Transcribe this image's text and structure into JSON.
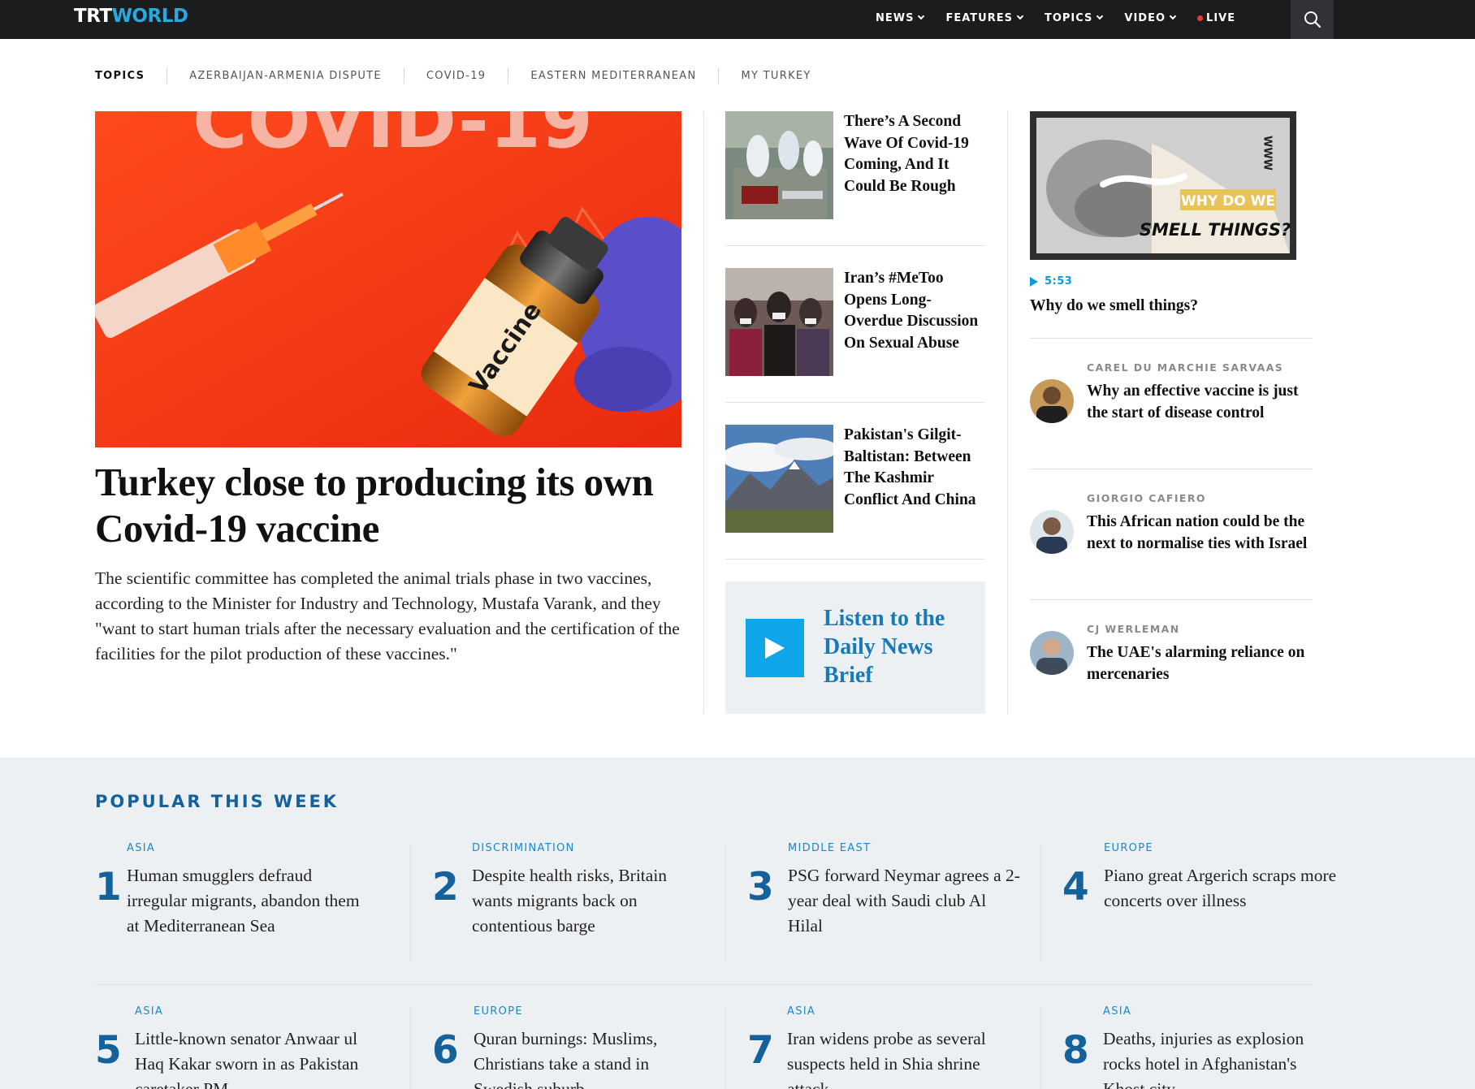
{
  "header": {
    "logo": {
      "part1": "TRT",
      "part2": "WORLD"
    },
    "nav": [
      {
        "label": "NEWS",
        "has_menu": true
      },
      {
        "label": "FEATURES",
        "has_menu": true
      },
      {
        "label": "TOPICS",
        "has_menu": true
      },
      {
        "label": "VIDEO",
        "has_menu": true
      },
      {
        "label": "LIVE",
        "has_menu": false
      }
    ],
    "search_icon": "search-icon"
  },
  "topics": {
    "label": "TOPICS",
    "items": [
      "AZERBAIJAN-ARMENIA DISPUTE",
      "COVID-19",
      "EASTERN MEDITERRANEAN",
      "MY TURKEY"
    ]
  },
  "lead": {
    "title": "Turkey close to producing its own Covid-19 vaccine",
    "summary": "The scientific committee has completed the animal trials phase in two vaccines, according to the Minister for Industry and Technology, Mustafa Varank, and they \"want to start human trials after the necessary evaluation and the certification of the facilities for the pilot production of these vaccines.\"",
    "image": {
      "banner_text": "COVID-19",
      "vial_label": "Vaccine"
    }
  },
  "middle": {
    "stories": [
      {
        "title": "There’s A Second Wave Of Covid-19 Coming, And It Could Be Rough"
      },
      {
        "title": "Iran’s #MeToo Opens Long-Overdue Discussion On Sexual Abuse"
      },
      {
        "title": "Pakistan's Gilgit-Baltistan: Between The Kashmir Conflict And China"
      }
    ],
    "podcast": {
      "label": "Listen to the Daily News Brief",
      "icon": "play-icon"
    }
  },
  "right": {
    "video": {
      "duration": "5:53",
      "title": "Why do we smell things?",
      "thumb_line1": "WHY DO WE",
      "thumb_line2": "SMELL THINGS?",
      "thumb_brand": "WWW"
    },
    "opinions": [
      {
        "author": "CAREL DU MARCHIE SARVAAS",
        "title": "Why an effective vaccine is just the start of disease control"
      },
      {
        "author": "GIORGIO CAFIERO",
        "title": "This African nation could be the next to normalise ties with Israel"
      },
      {
        "author": "CJ WERLEMAN",
        "title": "The UAE's alarming reliance on mercenaries"
      }
    ]
  },
  "popular": {
    "heading": "POPULAR THIS WEEK",
    "items": [
      {
        "rank": "1",
        "category": "ASIA",
        "title": "Human smugglers defraud irregular migrants, abandon them at Mediterranean Sea"
      },
      {
        "rank": "2",
        "category": "DISCRIMINATION",
        "title": "Despite health risks, Britain wants migrants back on contentious barge"
      },
      {
        "rank": "3",
        "category": "MIDDLE EAST",
        "title": "PSG forward Neymar agrees a 2-year deal with Saudi club Al Hilal"
      },
      {
        "rank": "4",
        "category": "EUROPE",
        "title": "Piano great Argerich scraps more concerts over illness"
      },
      {
        "rank": "5",
        "category": "ASIA",
        "title": "Little-known senator Anwaar ul Haq Kakar sworn in as Pakistan caretaker PM"
      },
      {
        "rank": "6",
        "category": "EUROPE",
        "title": "Quran burnings: Muslims, Christians take a stand in Swedish suburb"
      },
      {
        "rank": "7",
        "category": "ASIA",
        "title": "Iran widens probe as several suspects held in Shia shrine attack"
      },
      {
        "rank": "8",
        "category": "ASIA",
        "title": "Deaths, injuries as explosion rocks hotel in Afghanistan's Khost city"
      }
    ]
  },
  "colors": {
    "topbar": "#1b1c1e",
    "logo_accent": "#2aa9e0",
    "brand_blue": "#14619c",
    "category_blue": "#1b88c8",
    "podcast_blue": "#0fa6e9",
    "section_bg": "#edf0f3"
  }
}
